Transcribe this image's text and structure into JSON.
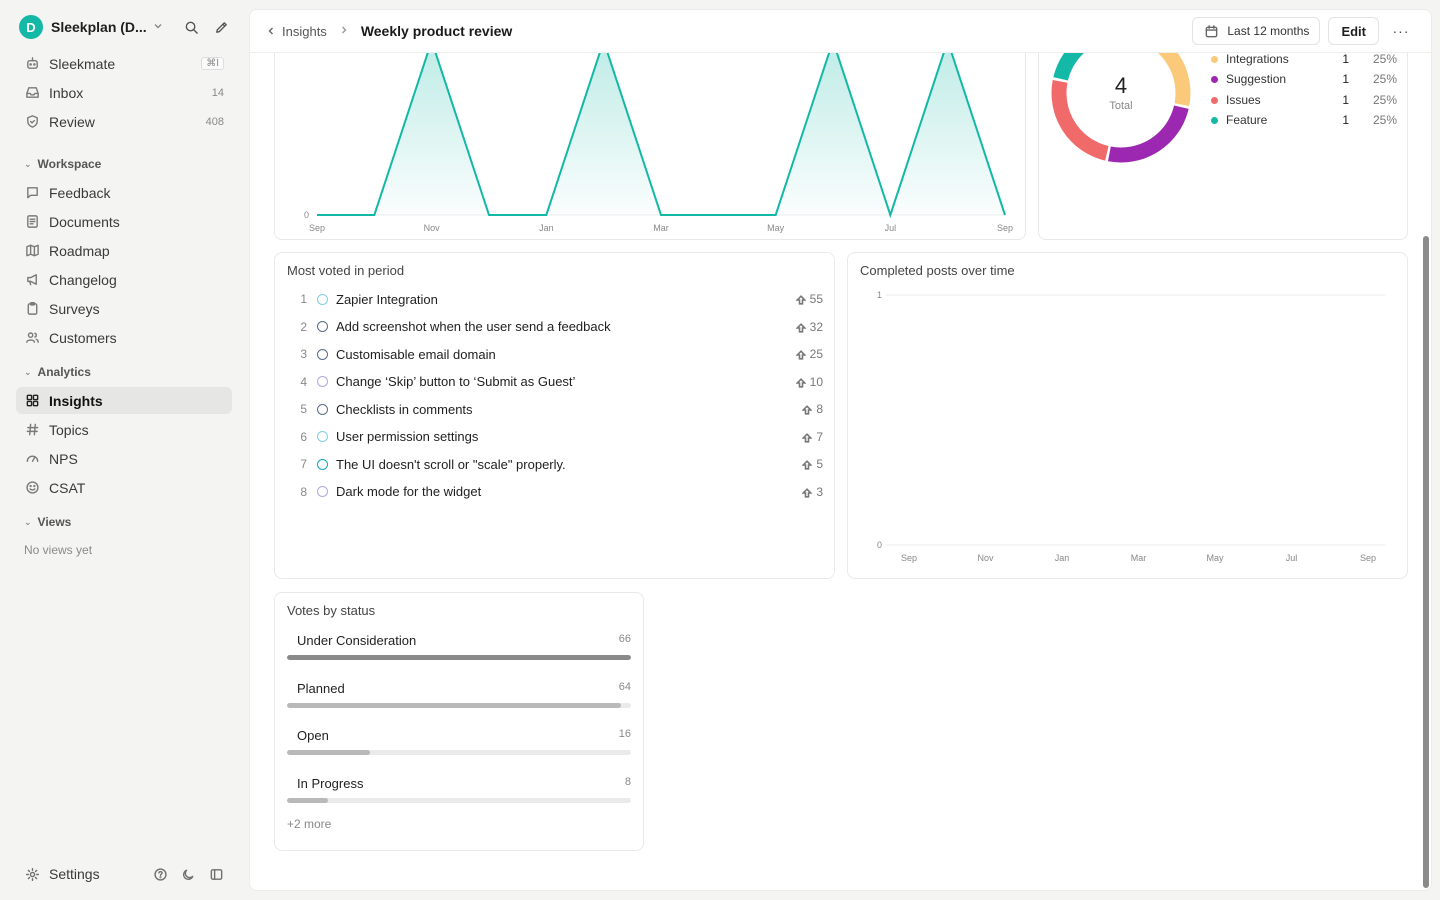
{
  "workspace": {
    "initial": "D",
    "name": "Sleekplan (D..."
  },
  "nav_top": [
    {
      "label": "Sleekmate",
      "kbd": "⌘I"
    },
    {
      "label": "Inbox",
      "count": "14"
    },
    {
      "label": "Review",
      "count": "408"
    }
  ],
  "sections": {
    "workspace": "Workspace",
    "analytics": "Analytics",
    "views": "Views"
  },
  "nav_workspace": [
    {
      "label": "Feedback"
    },
    {
      "label": "Documents"
    },
    {
      "label": "Roadmap"
    },
    {
      "label": "Changelog"
    },
    {
      "label": "Surveys"
    },
    {
      "label": "Customers"
    }
  ],
  "nav_analytics": [
    {
      "label": "Insights"
    },
    {
      "label": "Topics"
    },
    {
      "label": "NPS"
    },
    {
      "label": "CSAT"
    }
  ],
  "views_empty": "No views yet",
  "footer": {
    "settings_label": "Settings"
  },
  "topbar": {
    "back_label": "Insights",
    "current": "Weekly product review",
    "date_range": "Last 12 months",
    "edit_label": "Edit",
    "more": "···"
  },
  "colors": {
    "accent": "#14b8a6",
    "teal": "#14b8a6",
    "purple": "#9c27b0",
    "red": "#f06a6a",
    "yellow": "#fbc97a"
  },
  "donut": {
    "total": "4",
    "total_label": "Total",
    "legend": [
      {
        "label": "Integrations",
        "count": "1",
        "pct": "25%",
        "color": "#fbc97a"
      },
      {
        "label": "Suggestion",
        "count": "1",
        "pct": "25%",
        "color": "#9c27b0"
      },
      {
        "label": "Issues",
        "count": "1",
        "pct": "25%",
        "color": "#f06a6a"
      },
      {
        "label": "Feature",
        "count": "1",
        "pct": "25%",
        "color": "#14b8a6"
      }
    ]
  },
  "most_voted": {
    "title": "Most voted in period",
    "items": [
      {
        "rank": "1",
        "title": "Zapier Integration",
        "votes": "55",
        "status_color": "#7fd0e8"
      },
      {
        "rank": "2",
        "title": "Add screenshot when the user send a feedback",
        "votes": "32",
        "status_color": "#5a6b8a"
      },
      {
        "rank": "3",
        "title": "Customisable email domain",
        "votes": "25",
        "status_color": "#5a6b8a"
      },
      {
        "rank": "4",
        "title": "Change ‘Skip’ button to ‘Submit as Guest’",
        "votes": "10",
        "status_color": "#b3a7e0"
      },
      {
        "rank": "5",
        "title": "Checklists in comments",
        "votes": "8",
        "status_color": "#5a6b8a"
      },
      {
        "rank": "6",
        "title": "User permission settings",
        "votes": "7",
        "status_color": "#7fd0e8"
      },
      {
        "rank": "7",
        "title": "The UI doesn't scroll or \"scale\" properly.",
        "votes": "5",
        "status_color": "#14a3b8"
      },
      {
        "rank": "8",
        "title": "Dark mode for the widget",
        "votes": "3",
        "status_color": "#b3a7e0"
      }
    ]
  },
  "completed": {
    "title": "Completed posts over time"
  },
  "votes_by_status": {
    "title": "Votes by status",
    "more": "+2 more",
    "items": [
      {
        "label": "Under Consideration",
        "count": "66",
        "fraction": 1.0,
        "color": "#8a8a8a"
      },
      {
        "label": "Planned",
        "count": "64",
        "fraction": 0.97,
        "color": "#b9b9b9"
      },
      {
        "label": "Open",
        "count": "16",
        "fraction": 0.24,
        "color": "#b9b9b9"
      },
      {
        "label": "In Progress",
        "count": "8",
        "fraction": 0.12,
        "color": "#b9b9b9"
      }
    ]
  },
  "chart_data": [
    {
      "type": "area",
      "x": [
        "Sep",
        "Oct",
        "Nov",
        "Dec",
        "Jan",
        "Feb",
        "Mar",
        "Apr",
        "May",
        "Jun",
        "Jul",
        "Aug",
        "Sep"
      ],
      "x_tick_labels": [
        "Sep",
        "Nov",
        "Jan",
        "Mar",
        "May",
        "Jul",
        "Sep"
      ],
      "values": [
        0,
        0,
        1,
        0,
        0,
        1,
        0,
        0,
        0,
        1,
        0,
        1,
        0
      ],
      "ylim": [
        0,
        1
      ],
      "y_tick_labels": [
        "0"
      ],
      "grid": false
    },
    {
      "type": "pie",
      "categories": [
        "Integrations",
        "Suggestion",
        "Issues",
        "Feature"
      ],
      "values": [
        1,
        1,
        1,
        1
      ],
      "colors": [
        "#fbc97a",
        "#9c27b0",
        "#f06a6a",
        "#14b8a6"
      ]
    },
    {
      "type": "line",
      "x_tick_labels": [
        "Sep",
        "Nov",
        "Jan",
        "Mar",
        "May",
        "Jul",
        "Sep"
      ],
      "y_tick_labels": [
        "0",
        "1"
      ],
      "ylim": [
        0,
        1
      ],
      "values": [
        0,
        0,
        0,
        0,
        0,
        0,
        0
      ],
      "grid": true
    }
  ]
}
